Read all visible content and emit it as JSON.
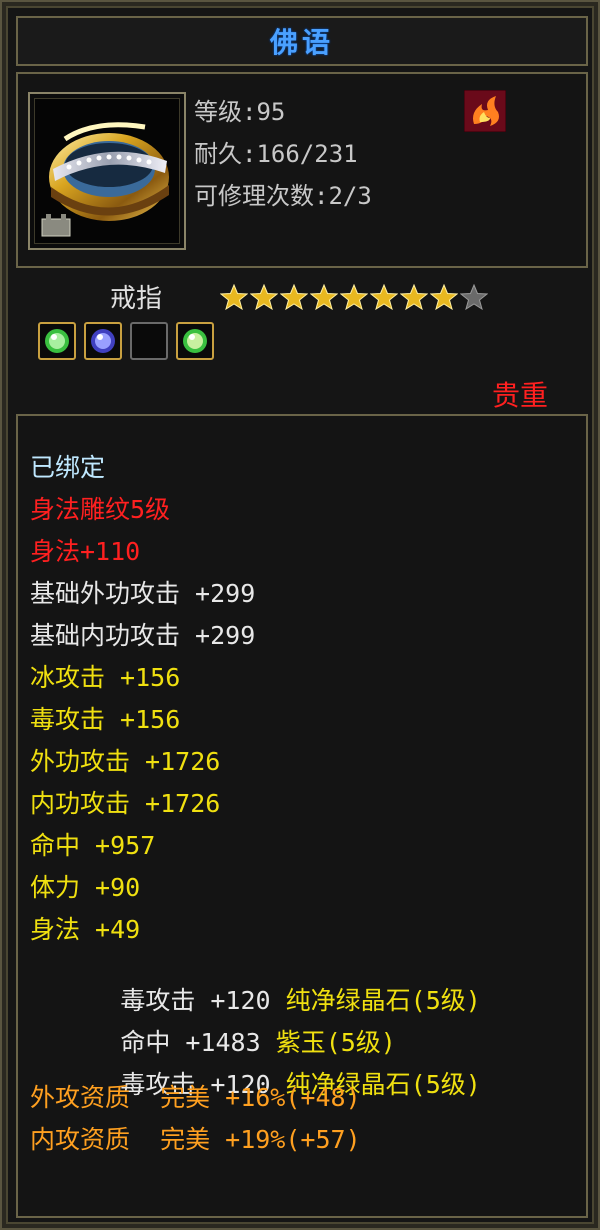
{
  "title": "佛语",
  "item": {
    "level": "等级:95",
    "durability": "耐久:166/231",
    "repair": "可修理次数:2/3",
    "name": "戒指",
    "stars_filled": 8,
    "stars_total": 9,
    "quality": "贵重",
    "gems": [
      "green-gem-icon",
      "purple-gem-icon",
      "empty-slot",
      "green-gem-icon"
    ]
  },
  "colors": {
    "bound": "#bfe8ff",
    "red": "#ff2020",
    "white": "#e8e8e8",
    "yellow": "#f0e010",
    "orange": "#ffa020",
    "gem_text": "#f0e010"
  },
  "attributes": [
    {
      "text": "已绑定",
      "color": "bound"
    },
    {
      "text": "身法雕纹5级",
      "color": "red"
    },
    {
      "text": "身法+110",
      "color": "red"
    },
    {
      "text": "基础外功攻击 +299",
      "color": "white"
    },
    {
      "text": "基础内功攻击 +299",
      "color": "white"
    },
    {
      "text": "冰攻击 +156",
      "color": "yellow"
    },
    {
      "text": "毒攻击 +156",
      "color": "yellow"
    },
    {
      "text": "外功攻击 +1726",
      "color": "yellow"
    },
    {
      "text": "内功攻击 +1726",
      "color": "yellow"
    },
    {
      "text": "命中 +957",
      "color": "yellow"
    },
    {
      "text": "体力 +90",
      "color": "yellow"
    },
    {
      "text": "身法 +49",
      "color": "yellow"
    }
  ],
  "gem_attributes": [
    {
      "stat": "毒攻击 +120",
      "gem": "纯净绿晶石(5级)"
    },
    {
      "stat": "命中 +1483",
      "gem": "紫玉(5级)"
    },
    {
      "stat": "毒攻击 +120",
      "gem": "纯净绿晶石(5级)"
    }
  ],
  "aptitudes": [
    {
      "text": "外攻资质  完美 +16%(+48)"
    },
    {
      "text": "内攻资质  完美 +19%(+57)"
    }
  ]
}
